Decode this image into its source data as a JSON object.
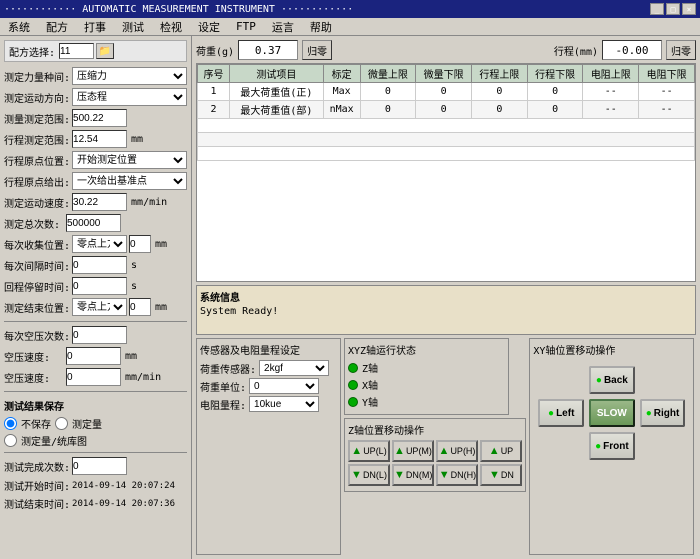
{
  "window": {
    "title": "AUTOMATIC MEASUREMENT INSTRUMENT",
    "title_dots_left": "············",
    "title_dots_right": "············"
  },
  "menu": {
    "items": [
      "系统",
      "配方",
      "打事",
      "测试",
      "检视",
      "设定",
      "FTP",
      "运言",
      "帮助"
    ]
  },
  "config_selector": {
    "label": "配方选择:",
    "value": "11"
  },
  "left_panel": {
    "fields": [
      {
        "label": "测定力量种间:",
        "type": "select",
        "value": "压缩力"
      },
      {
        "label": "测定运动方向:",
        "type": "select",
        "value": "压态程"
      },
      {
        "label": "测量测定范围:",
        "type": "input",
        "value": "500.22",
        "unit": ""
      },
      {
        "label": "行程测定范围:",
        "type": "input",
        "value": "12.54",
        "unit": "mm"
      },
      {
        "label": "行程原点位置:",
        "type": "select",
        "value": "开始测定位置"
      },
      {
        "label": "行程原点给出:",
        "type": "select",
        "value": "一次给出基准点"
      },
      {
        "label": "测定运动速度:",
        "type": "input",
        "value": "30.22",
        "unit": "mm/min"
      },
      {
        "label": "测定总次数:",
        "type": "input",
        "value": "500000",
        "unit": ""
      },
      {
        "label": "每次收集位置:",
        "type": "select_input",
        "select": "零点上方",
        "value": "0",
        "unit": "mm"
      },
      {
        "label": "每次间隔时间:",
        "type": "input",
        "value": "0",
        "unit": "s"
      },
      {
        "label": "回程停留时间:",
        "type": "input",
        "value": "0",
        "unit": "s"
      },
      {
        "label": "测定结束位置:",
        "type": "select_input",
        "select": "零点上方",
        "value": "0",
        "unit": "mm"
      }
    ]
  },
  "bottom_left": {
    "fields": [
      {
        "label": "每次空压次数:",
        "value": "0",
        "unit": ""
      },
      {
        "label": "空压速度:",
        "value": "0",
        "unit": "mm"
      },
      {
        "label": "空压速度2:",
        "value": "0",
        "unit": "mm/min"
      }
    ],
    "save_section": {
      "label": "测试结果保存",
      "options": [
        "不保存",
        "测定量",
        "测定量/统库图"
      ]
    },
    "stats": [
      {
        "label": "测试完成次数:",
        "value": "0"
      },
      {
        "label": "测试开始时间:",
        "value": "2014-09-14 20:07:24"
      },
      {
        "label": "测试结束时间:",
        "value": "2014-09-14 20:07:36"
      }
    ]
  },
  "measurements": {
    "load_label": "荷重(g)",
    "load_value": "0.37",
    "load_btn": "归零",
    "stroke_label": "行程(mm)",
    "stroke_value": "-0.00",
    "stroke_btn": "归零"
  },
  "table": {
    "headers": [
      "序号",
      "测试项目",
      "标定",
      "微量上限",
      "微量下限",
      "行程上限",
      "行程下限",
      "电阻上限",
      "电阻下限"
    ],
    "rows": [
      [
        "1",
        "最大荷重值(正)",
        "Max",
        "0",
        "0",
        "0",
        "0",
        "--",
        "--"
      ],
      [
        "2",
        "最大荷重值(部)",
        "nMax",
        "0",
        "0",
        "0",
        "0",
        "--",
        "--"
      ]
    ]
  },
  "system_info": {
    "label": "系统信息",
    "text": "System Ready!"
  },
  "sensor_panel": {
    "title": "传感器及电阻量程设定",
    "fields": [
      {
        "label": "荷重传感器:",
        "type": "select",
        "value": "2kgf"
      },
      {
        "label": "荷重单位:",
        "type": "select",
        "value": "0"
      },
      {
        "label": "电阻量程:",
        "type": "select",
        "value": "10kue"
      }
    ]
  },
  "xy_motion": {
    "title": "XYZ轴运行状态",
    "axes": [
      {
        "label": "Z轴",
        "active": true
      },
      {
        "label": "X轴",
        "active": true
      },
      {
        "label": "Y轴",
        "active": true
      }
    ]
  },
  "xy_position": {
    "title": "XY轴位置移动操作",
    "buttons": {
      "back": "Back",
      "left": "Left",
      "slow": "SLOW",
      "right": "Right",
      "front": "Front"
    }
  },
  "z_motion": {
    "title": "Z轴位置移动操作",
    "up_buttons": [
      "UP(L)",
      "UP(M)",
      "UP(H)",
      "UP"
    ],
    "dn_buttons": [
      "DN(L)",
      "DN(M)",
      "DN(H)",
      "DN"
    ]
  }
}
